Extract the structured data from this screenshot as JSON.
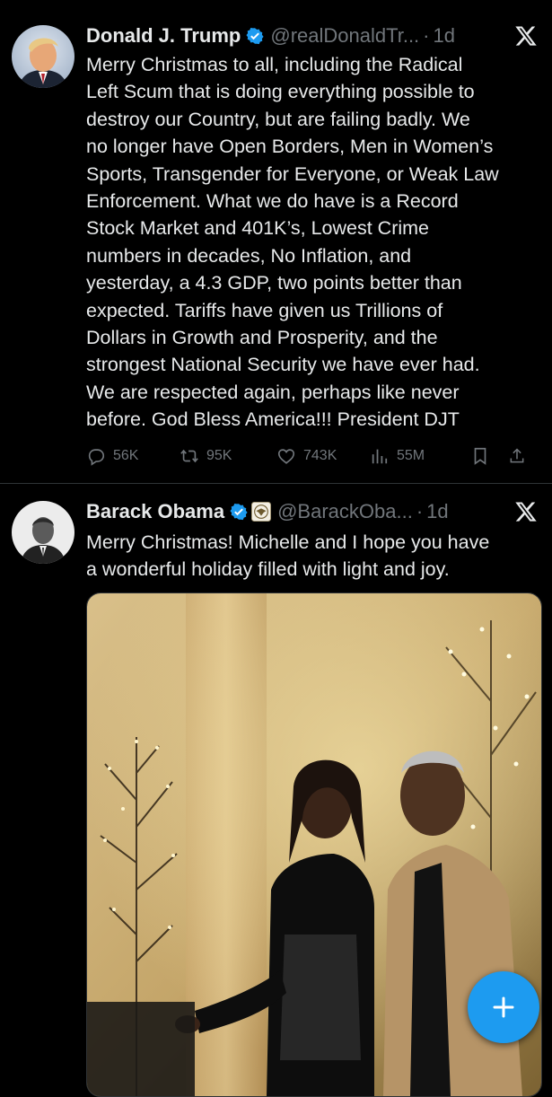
{
  "colors": {
    "background": "#000000",
    "accent": "#1d9bf0",
    "text": "#e7e9ea",
    "muted": "#71767b",
    "verified": "#1d9bf0"
  },
  "tweets": [
    {
      "name": "Donald J. Trump",
      "handle": "@realDonaldTr...",
      "separator": "·",
      "time": "1d",
      "text": "Merry Christmas to all, including the Radical\nLeft Scum that is doing everything possible to\ndestroy our Country, but are failing badly. We\nno longer have Open Borders, Men in Women’s\nSports, Transgender for Everyone, or Weak Law\nEnforcement. What we do have is a Record\nStock Market and 401K’s, Lowest Crime\nnumbers in decades, No Inflation, and\nyesterday, a 4.3 GDP, two points better than\nexpected. Tariffs have given us Trillions of\nDollars in Growth and Prosperity, and the\nstrongest National Security we have ever had.\nWe are respected again, perhaps like never\nbefore. God Bless America!!! President DJT",
      "replies": "56K",
      "reposts": "95K",
      "likes": "743K",
      "views": "55M",
      "icons": [
        "verified-badge",
        "x-logo",
        "reply-icon",
        "repost-icon",
        "like-icon",
        "views-icon",
        "bookmark-icon",
        "share-icon"
      ]
    },
    {
      "name": "Barack Obama",
      "handle": "@BarackOba...",
      "separator": "·",
      "time": "1d",
      "text": "Merry Christmas! Michelle and I hope you have\na wonderful holiday filled with light and joy.",
      "icons": [
        "verified-badge",
        "government-seal-icon",
        "x-logo"
      ]
    }
  ],
  "compose_button": {
    "icon": "plus-icon"
  }
}
